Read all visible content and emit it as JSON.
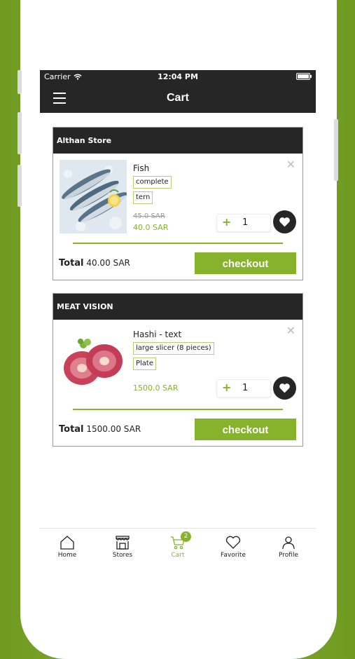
{
  "status_bar": {
    "carrier": "Carrier",
    "time": "12:04 PM"
  },
  "header": {
    "title": "Cart"
  },
  "stores": [
    {
      "name": "Althan Store",
      "item": {
        "name": "Fish",
        "options": [
          "complete",
          "tern"
        ],
        "old_price": "45.0 SAR",
        "price": "40.0 SAR",
        "quantity": "1",
        "image": "fish-image"
      },
      "total_label": "Total",
      "total_value": "40.00 SAR",
      "checkout_label": "checkout"
    },
    {
      "name": "MEAT VISION",
      "item": {
        "name": "Hashi - text",
        "options": [
          "large slicer (8 pieces)",
          "Plate"
        ],
        "price": "1500.0 SAR",
        "quantity": "1",
        "image": "meat-image"
      },
      "total_label": "Total",
      "total_value": "1500.00 SAR",
      "checkout_label": "checkout"
    }
  ],
  "tabbar": {
    "items": [
      {
        "label": "Home",
        "icon": "home-icon"
      },
      {
        "label": "Stores",
        "icon": "store-icon"
      },
      {
        "label": "Cart",
        "icon": "cart-icon",
        "badge": "2",
        "active": true
      },
      {
        "label": "Favorite",
        "icon": "heart-icon"
      },
      {
        "label": "Profile",
        "icon": "person-icon"
      }
    ]
  },
  "colors": {
    "accent": "#86b22c",
    "dark": "#262626",
    "background": "#7aa428"
  }
}
